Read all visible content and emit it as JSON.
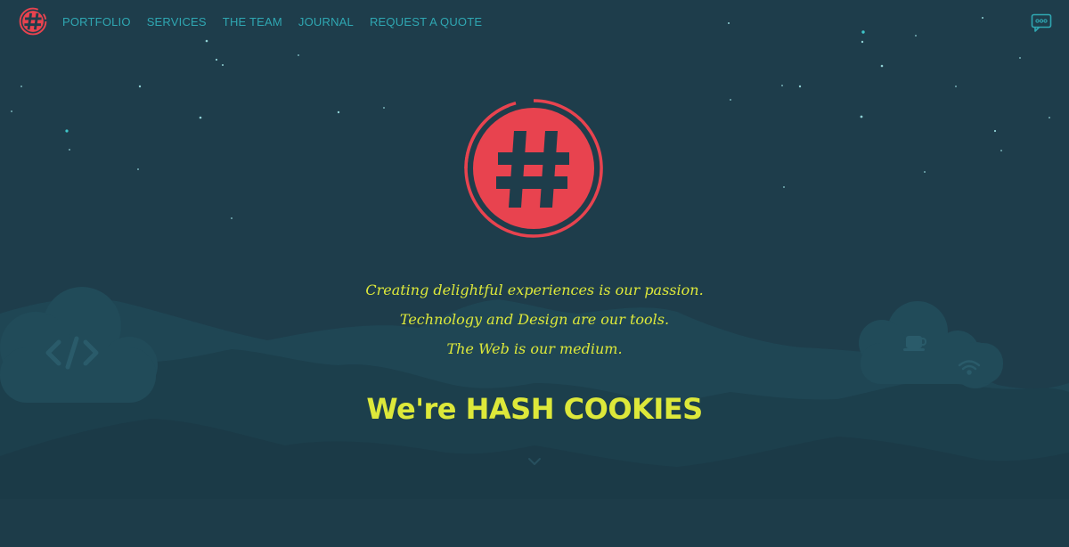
{
  "nav": {
    "links": [
      {
        "label": "PORTFOLIO"
      },
      {
        "label": "SERVICES"
      },
      {
        "label": "THE TEAM"
      },
      {
        "label": "JOURNAL"
      },
      {
        "label": "REQUEST A QUOTE"
      }
    ],
    "logo_icon": "hash-logo-icon",
    "chat_icon": "chat-bubble-icon"
  },
  "hero": {
    "logo_icon": "hash-logo-icon",
    "tagline": [
      "Creating delightful experiences is our passion.",
      "Technology and Design are our tools.",
      "The Web is our medium."
    ],
    "heading": "We're HASH COOKIES",
    "scroll_icon": "chevron-down-icon"
  },
  "decor": {
    "left_cloud_icon": "code-icon",
    "right_cloud_icons": [
      "coffee-icon",
      "wifi-icon"
    ]
  },
  "colors": {
    "background": "#1e3d4b",
    "accent_red": "#e8434f",
    "headline_yellow": "#dde83a",
    "nav_teal": "#2fa7b2"
  }
}
